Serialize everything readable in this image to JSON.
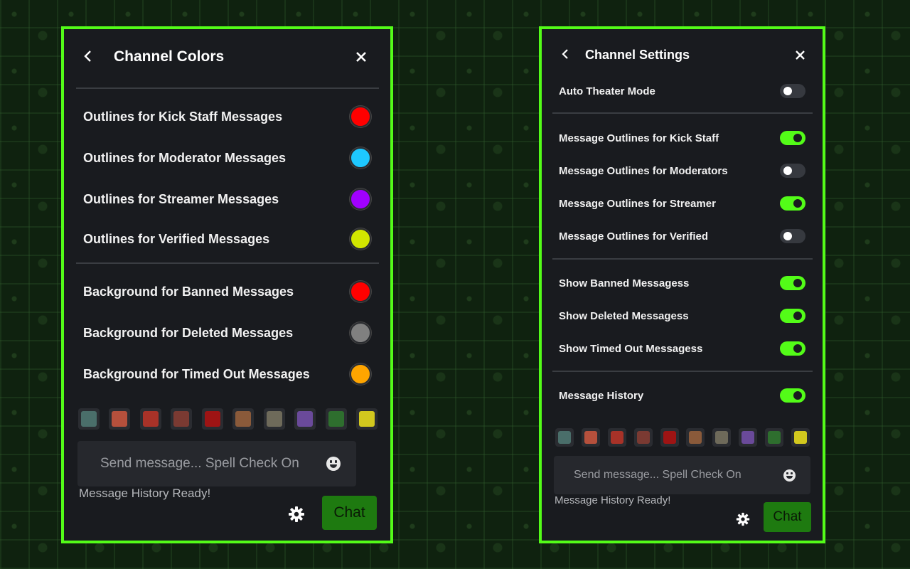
{
  "left_panel": {
    "title": "Channel Colors",
    "rows": [
      {
        "label": "Outlines for Kick Staff Messages",
        "color": "#ff0000"
      },
      {
        "label": "Outlines for Moderator Messages",
        "color": "#1ec8ff"
      },
      {
        "label": "Outlines for Streamer Messages",
        "color": "#a100ff"
      },
      {
        "label": "Outlines for Verified Messages",
        "color": "#d2e600"
      },
      {
        "label": "Background for Banned Messages",
        "color": "#ff0000"
      },
      {
        "label": "Background for Deleted Messages",
        "color": "#808080"
      },
      {
        "label": "Background for Timed Out Messages",
        "color": "#ffa500"
      }
    ],
    "input_placeholder": "Send message... Spell Check On",
    "status": "Message History Ready!",
    "chat_label": "Chat"
  },
  "right_panel": {
    "title": "Channel Settings",
    "rows": [
      {
        "label": "Auto Theater Mode",
        "on": false
      },
      {
        "label": "Message Outlines for Kick Staff",
        "on": true
      },
      {
        "label": "Message Outlines for Moderators",
        "on": false
      },
      {
        "label": "Message Outlines for Streamer",
        "on": true
      },
      {
        "label": "Message Outlines for Verified",
        "on": false
      },
      {
        "label": "Show Banned Messagess",
        "on": true
      },
      {
        "label": "Show Deleted Messagess",
        "on": true
      },
      {
        "label": "Show Timed Out Messagess",
        "on": true
      },
      {
        "label": "Message History",
        "on": true
      }
    ],
    "input_placeholder": "Send message... Spell Check On",
    "status": "Message History Ready!",
    "chat_label": "Chat"
  },
  "emotes": [
    {
      "name": "emote-1",
      "color": "#4a6e6a"
    },
    {
      "name": "emote-2",
      "color": "#b5503c"
    },
    {
      "name": "emote-3",
      "color": "#a83228"
    },
    {
      "name": "emote-4",
      "color": "#7a3a32"
    },
    {
      "name": "emote-5",
      "color": "#9e1414"
    },
    {
      "name": "emote-6",
      "color": "#8a5a3a"
    },
    {
      "name": "emote-7",
      "color": "#6e6a5a"
    },
    {
      "name": "emote-8",
      "color": "#6a4a9a"
    },
    {
      "name": "emote-9",
      "color": "#2e6e2e"
    },
    {
      "name": "emote-10",
      "color": "#d2c81e"
    }
  ],
  "icons": {
    "back": "chevron-left-icon",
    "close": "close-icon",
    "emoji": "smiley-icon",
    "settings": "gear-icon"
  },
  "colors": {
    "accent": "#53fc18",
    "panel_bg": "#191b1f",
    "chat_button": "#1e7a10"
  }
}
